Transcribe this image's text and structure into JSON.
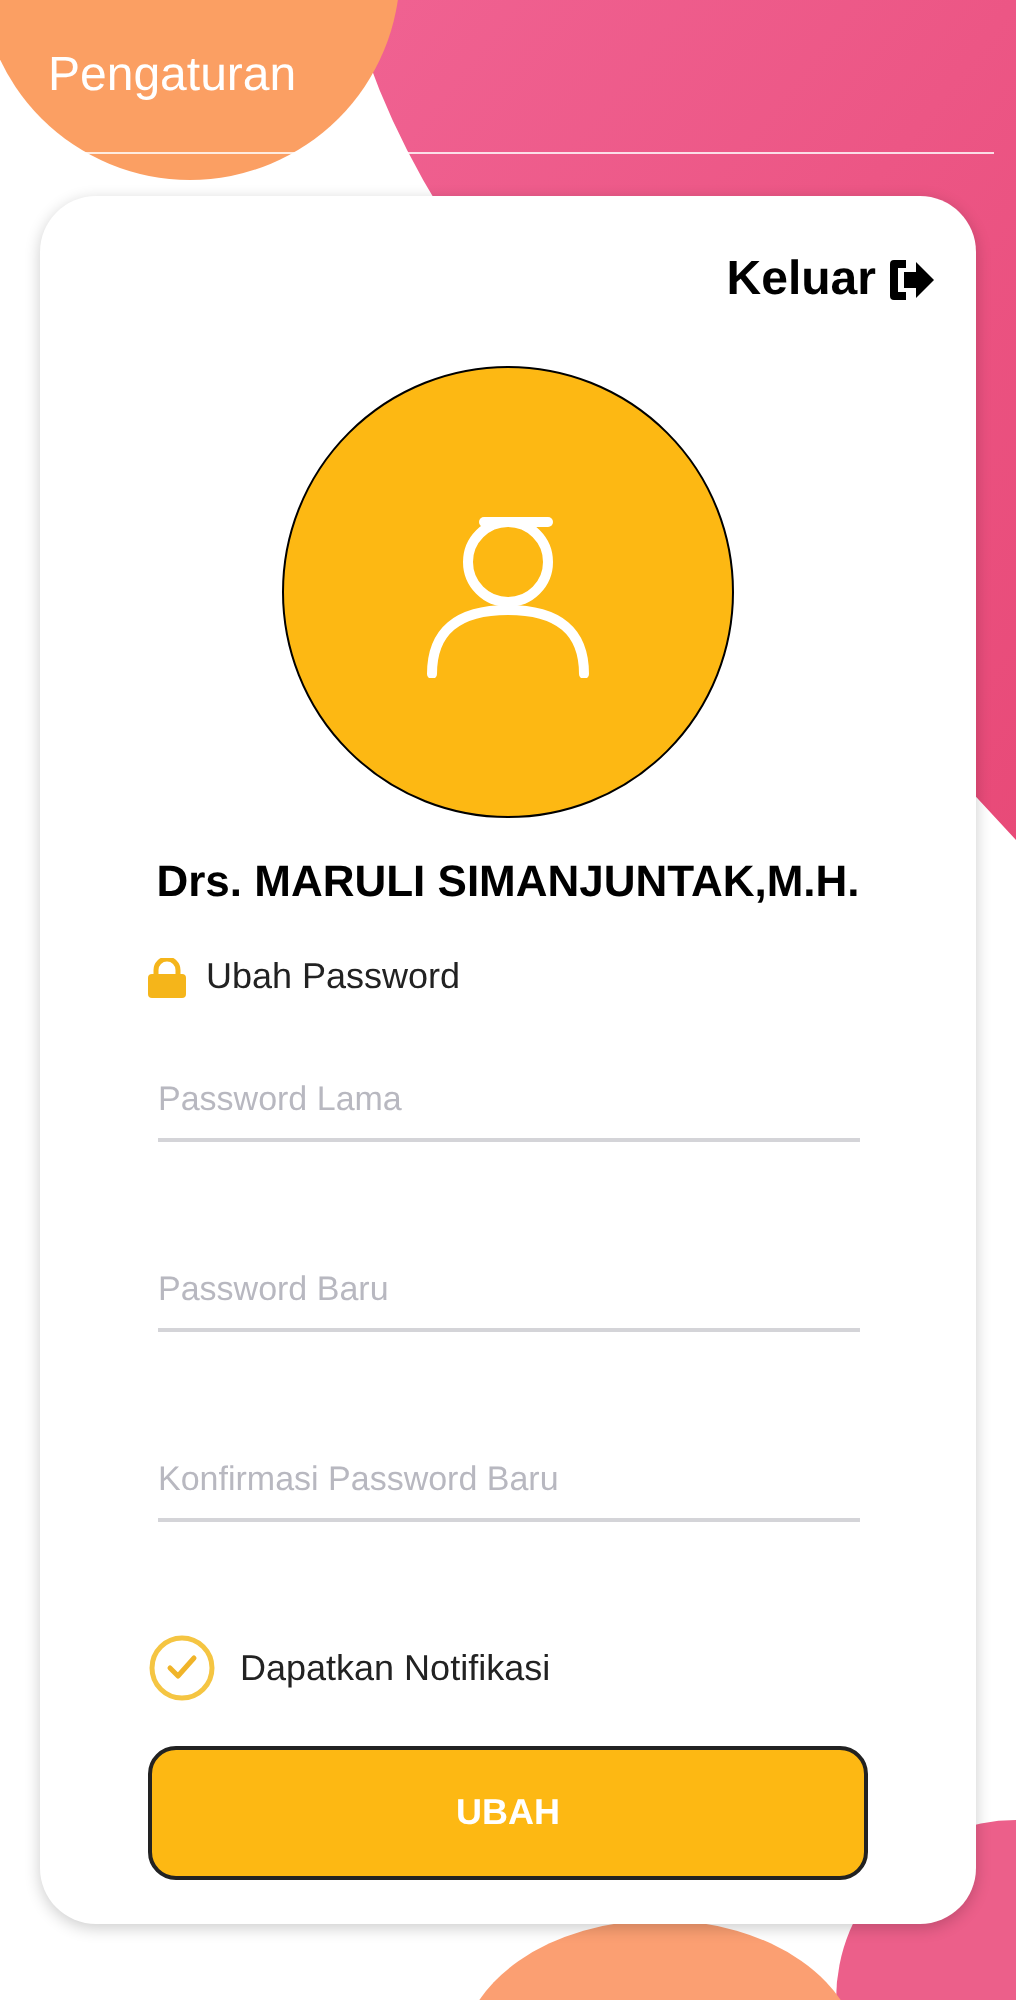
{
  "header": {
    "title": "Pengaturan"
  },
  "logout": {
    "label": "Keluar"
  },
  "profile": {
    "name": "Drs. MARULI SIMANJUNTAK,M.H."
  },
  "section": {
    "title": "Ubah Password"
  },
  "fields": [
    {
      "placeholder": "Password Lama"
    },
    {
      "placeholder": "Password Baru"
    },
    {
      "placeholder": "Konfirmasi Password Baru"
    }
  ],
  "notification": {
    "label": "Dapatkan Notifikasi",
    "checked": true
  },
  "submit": {
    "label": "UBAH"
  }
}
